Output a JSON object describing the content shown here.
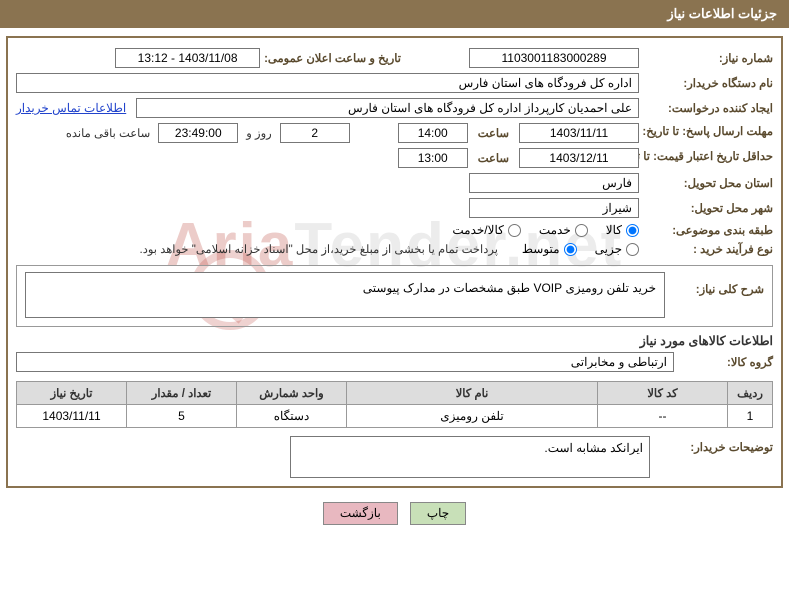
{
  "header": {
    "title": "جزئیات اطلاعات نیاز"
  },
  "watermark": {
    "p1": "Aria",
    "p2": "Tender",
    "p3": ".net"
  },
  "need_no": {
    "label": "شماره نیاز:",
    "value": "1103001183000289"
  },
  "announce": {
    "label": "تاریخ و ساعت اعلان عمومی:",
    "value": "1403/11/08 - 13:12"
  },
  "buyer_org": {
    "label": "نام دستگاه خریدار:",
    "value": "اداره کل فرودگاه های استان فارس"
  },
  "requester": {
    "label": "ایجاد کننده درخواست:",
    "value": "علی  احمدیان کارپرداز اداره کل فرودگاه های استان فارس"
  },
  "contact_link": "اطلاعات تماس خریدار",
  "reply_deadline": {
    "label": "مهلت ارسال پاسخ: تا تاریخ:",
    "date": "1403/11/11",
    "time_lbl": "ساعت",
    "time": "14:00",
    "days": "2",
    "days_lbl": "روز و",
    "remain": "23:49:00",
    "remain_lbl": "ساعت باقی مانده"
  },
  "price_validity": {
    "label": "حداقل تاریخ اعتبار قیمت: تا تاریخ:",
    "date": "1403/12/11",
    "time_lbl": "ساعت",
    "time": "13:00"
  },
  "deliver_province": {
    "label": "استان محل تحویل:",
    "value": "فارس"
  },
  "deliver_city": {
    "label": "شهر محل تحویل:",
    "value": "شیراز"
  },
  "subject_class": {
    "label": "طبقه بندی موضوعی:",
    "opts": [
      "کالا",
      "خدمت",
      "کالا/خدمت"
    ],
    "selected": 0
  },
  "buy_process": {
    "label": "نوع فرآیند خرید :",
    "opts": [
      "جزیی",
      "متوسط"
    ],
    "selected": 1,
    "note": "پرداخت تمام یا بخشی از مبلغ خرید،از محل \"اسناد خزانه اسلامی\" خواهد بود."
  },
  "overall_desc": {
    "label": "شرح کلی نیاز:",
    "value": "خرید تلفن رومیزی VOIP طبق مشخصات در مدارک پیوستی"
  },
  "goods_section_title": "اطلاعات کالاهای مورد نیاز",
  "goods_group": {
    "label": "گروه کالا:",
    "value": "ارتباطی و مخابراتی"
  },
  "table": {
    "headers": [
      "ردیف",
      "کد کالا",
      "نام کالا",
      "واحد شمارش",
      "تعداد / مقدار",
      "تاریخ نیاز"
    ],
    "rows": [
      {
        "row": "1",
        "code": "--",
        "name": "تلفن رومیزی",
        "unit": "دستگاه",
        "qty": "5",
        "date": "1403/11/11"
      }
    ]
  },
  "buyer_notes": {
    "label": "توضیحات خریدار:",
    "value": "ایرانکد مشابه است."
  },
  "buttons": {
    "print": "چاپ",
    "back": "بازگشت"
  }
}
